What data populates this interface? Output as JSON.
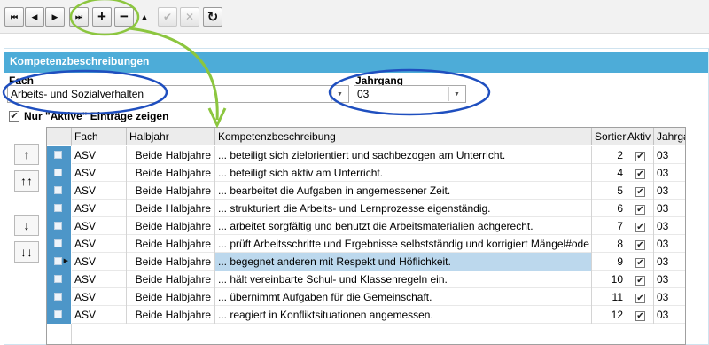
{
  "toolbar": {
    "buttons": [
      {
        "name": "first",
        "glyph": "⏮"
      },
      {
        "name": "previous",
        "glyph": "◀"
      },
      {
        "name": "next",
        "glyph": "▶"
      },
      {
        "name": "last",
        "glyph": "⏭"
      },
      {
        "name": "add",
        "glyph": "+"
      },
      {
        "name": "delete",
        "glyph": "−"
      },
      {
        "name": "edit",
        "glyph": "▲"
      },
      {
        "name": "confirm",
        "glyph": "✔"
      },
      {
        "name": "cancel",
        "glyph": "✕"
      },
      {
        "name": "refresh",
        "glyph": "↻"
      }
    ]
  },
  "panel": {
    "title": "Kompetenzbeschreibungen",
    "fach_label": "Fach",
    "fach_value": "Arbeits- und Sozialverhalten",
    "jahrgang_label": "Jahrgang",
    "jahrgang_value": "03",
    "only_active_label": "Nur \"Aktive\" Einträge zeigen",
    "only_active_checked": "✔"
  },
  "move_buttons": {
    "up": "↑",
    "top": "↑↑",
    "down": "↓",
    "bottom": "↓↓"
  },
  "grid": {
    "headers": {
      "fach": "Fach",
      "halbjahr": "Halbjahr",
      "kompetenz": "Kompetenzbeschreibung",
      "sortierung": "Sortierung",
      "aktiv": "Aktiv",
      "jahrgang": "Jahrgang"
    },
    "rows": [
      {
        "fach": "ASV",
        "halbjahr": "Beide Halbjahre",
        "kompetenz": "... beteiligt sich zielorientiert und sachbezogen am Unterricht.",
        "sort": "2",
        "aktiv": "✔",
        "jahrgang": "03"
      },
      {
        "fach": "ASV",
        "halbjahr": "Beide Halbjahre",
        "kompetenz": "... beteiligt sich aktiv am Unterricht.",
        "sort": "4",
        "aktiv": "✔",
        "jahrgang": "03"
      },
      {
        "fach": "ASV",
        "halbjahr": "Beide Halbjahre",
        "kompetenz": "... bearbeitet die Aufgaben in angemessener Zeit.",
        "sort": "5",
        "aktiv": "✔",
        "jahrgang": "03"
      },
      {
        "fach": "ASV",
        "halbjahr": "Beide Halbjahre",
        "kompetenz": "... strukturiert die Arbeits- und Lernprozesse eigenständig.",
        "sort": "6",
        "aktiv": "✔",
        "jahrgang": "03"
      },
      {
        "fach": "ASV",
        "halbjahr": "Beide Halbjahre",
        "kompetenz": "... arbeitet sorgfältig und benutzt die Arbeitsmaterialien achgerecht.",
        "sort": "7",
        "aktiv": "✔",
        "jahrgang": "03"
      },
      {
        "fach": "ASV",
        "halbjahr": "Beide Halbjahre",
        "kompetenz": "... prüft Arbeitsschritte und Ergebnisse selbstständig und korrigiert Mängel#ode",
        "sort": "8",
        "aktiv": "✔",
        "jahrgang": "03"
      },
      {
        "fach": "ASV",
        "halbjahr": "Beide Halbjahre",
        "kompetenz": "... begegnet anderen mit Respekt und Höflichkeit.",
        "sort": "9",
        "aktiv": "✔",
        "jahrgang": "03"
      },
      {
        "fach": "ASV",
        "halbjahr": "Beide Halbjahre",
        "kompetenz": "... hält vereinbarte Schul- und Klassenregeln ein.",
        "sort": "10",
        "aktiv": "✔",
        "jahrgang": "03"
      },
      {
        "fach": "ASV",
        "halbjahr": "Beide Halbjahre",
        "kompetenz": "... übernimmt Aufgaben für die Gemeinschaft.",
        "sort": "11",
        "aktiv": "✔",
        "jahrgang": "03"
      },
      {
        "fach": "ASV",
        "halbjahr": "Beide Halbjahre",
        "kompetenz": "... reagiert in Konfliktsituationen angemessen.",
        "sort": "12",
        "aktiv": "✔",
        "jahrgang": "03"
      }
    ],
    "current_row": 6
  },
  "colors": {
    "header_blue": "#4dacd8",
    "selector_blue": "#4d96c8",
    "annotation_green": "#8cc63f",
    "annotation_blue": "#1f4fbf"
  }
}
